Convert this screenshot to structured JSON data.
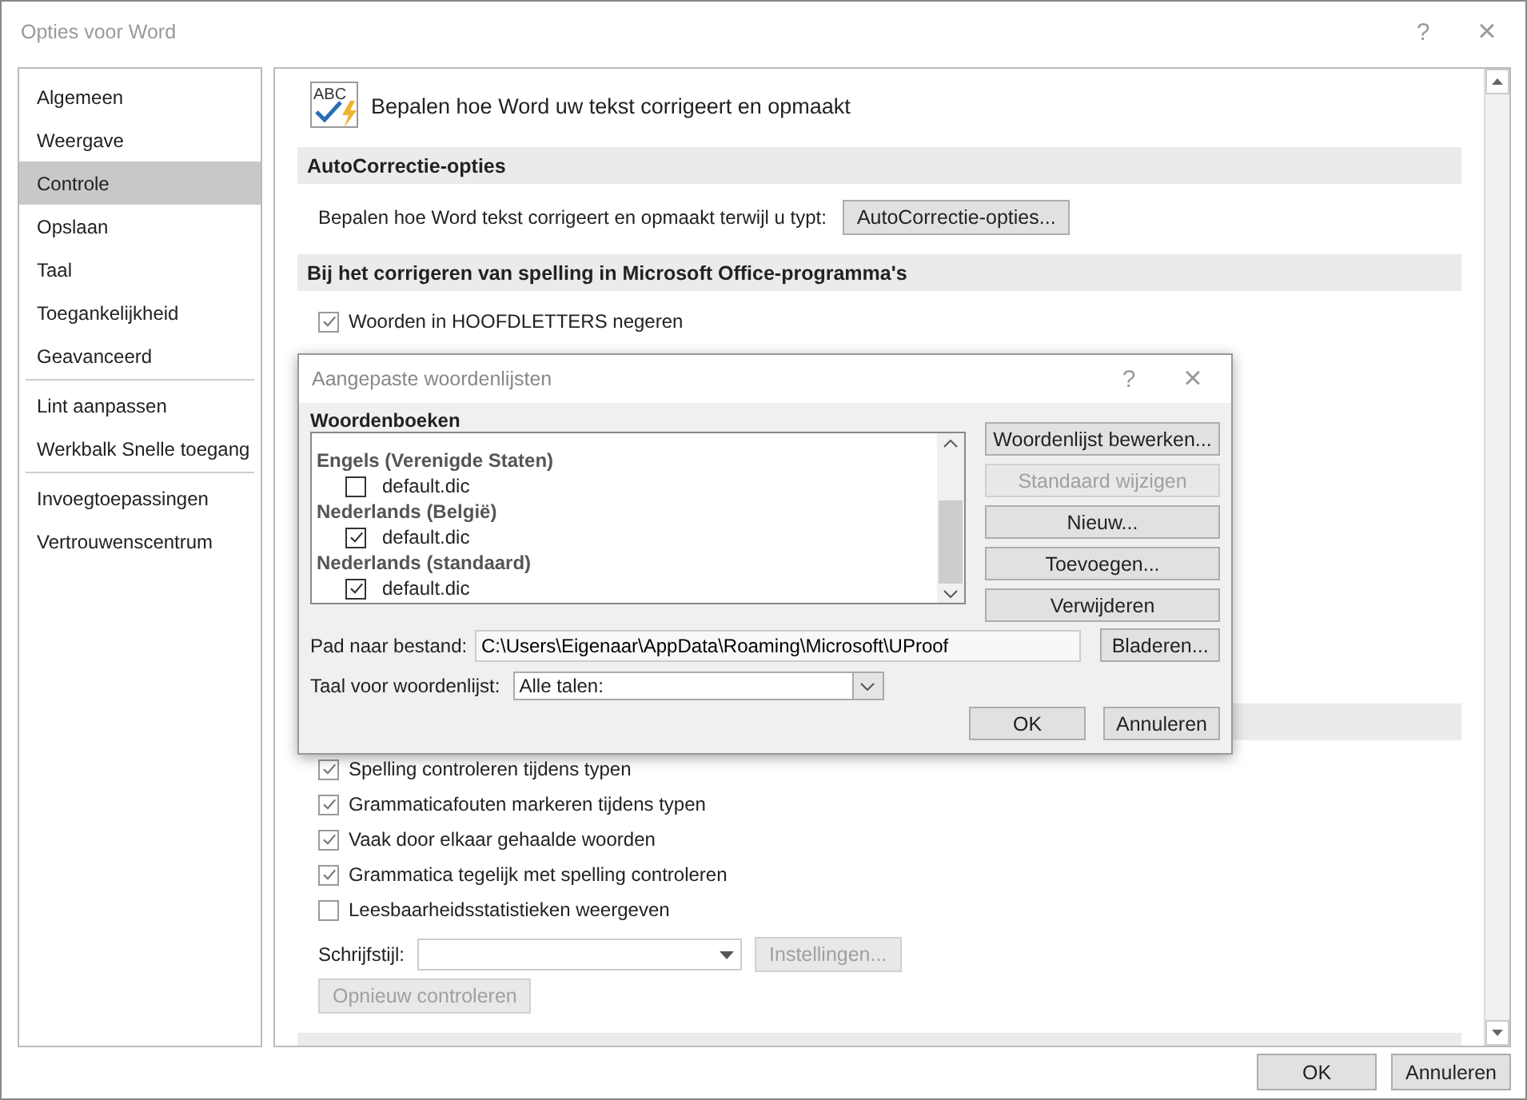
{
  "window": {
    "title": "Opties voor Word",
    "help": "?",
    "close": "×"
  },
  "sidebar": {
    "groups": [
      [
        {
          "label": "Algemeen",
          "selected": false
        },
        {
          "label": "Weergave",
          "selected": false
        },
        {
          "label": "Controle",
          "selected": true
        },
        {
          "label": "Opslaan",
          "selected": false
        },
        {
          "label": "Taal",
          "selected": false
        },
        {
          "label": "Toegankelijkheid",
          "selected": false
        },
        {
          "label": "Geavanceerd",
          "selected": false
        }
      ],
      [
        {
          "label": "Lint aanpassen",
          "selected": false
        },
        {
          "label": "Werkbalk Snelle toegang",
          "selected": false
        }
      ],
      [
        {
          "label": "Invoegtoepassingen",
          "selected": false
        },
        {
          "label": "Vertrouwenscentrum",
          "selected": false
        }
      ]
    ]
  },
  "main": {
    "icon_text": "ABC",
    "heading": "Bepalen hoe Word uw tekst corrigeert en opmaakt",
    "autocorrect": {
      "title": "AutoCorrectie-opties",
      "description": "Bepalen hoe Word tekst corrigeert en opmaakt terwijl u typt:",
      "button": "AutoCorrectie-opties..."
    },
    "spelling_office": {
      "title": "Bij het corrigeren van spelling in Microsoft Office-programma's",
      "options": [
        {
          "label": "Woorden in HOOFDLETTERS negeren",
          "checked": true
        }
      ]
    },
    "spelling_word": {
      "options": [
        {
          "label": "Spelling controleren tijdens typen",
          "checked": true
        },
        {
          "label": "Grammaticafouten markeren tijdens typen",
          "checked": true
        },
        {
          "label": "Vaak door elkaar gehaalde woorden",
          "checked": true
        },
        {
          "label": "Grammatica tegelijk met spelling controleren",
          "checked": true
        },
        {
          "label": "Leesbaarheidsstatistieken weergeven",
          "checked": false
        }
      ],
      "style_label": "Schrijfstijl:",
      "settings_button": {
        "label": "Instellingen...",
        "disabled": true
      },
      "recheck_button": {
        "label": "Opnieuw controleren",
        "disabled": true
      }
    }
  },
  "buttons": [
    {
      "label": "OK"
    },
    {
      "label": "Annuleren"
    }
  ],
  "dialog": {
    "title": "Aangepaste woordenlijsten",
    "help": "?",
    "close": "×",
    "list_title": "Woordenboeken",
    "dictionaries": [
      {
        "language": "Engels (Verenigde Staten)",
        "items": [
          {
            "name": "default.dic",
            "checked": false
          }
        ]
      },
      {
        "language": "Nederlands (België)",
        "items": [
          {
            "name": "default.dic",
            "checked": true
          }
        ]
      },
      {
        "language": "Nederlands (standaard)",
        "items": [
          {
            "name": "default.dic",
            "checked": true
          }
        ]
      }
    ],
    "side_buttons": [
      {
        "label": "Woordenlijst bewerken...",
        "disabled": false
      },
      {
        "label": "Standaard wijzigen",
        "disabled": true
      },
      {
        "label": "Nieuw...",
        "disabled": false
      },
      {
        "label": "Toevoegen...",
        "disabled": false
      },
      {
        "label": "Verwijderen",
        "disabled": false
      }
    ],
    "path_label": "Pad naar bestand:",
    "path": "C:\\Users\\Eigenaar\\AppData\\Roaming\\Microsoft\\UProof",
    "browse_button": "Bladeren...",
    "language_label": "Taal voor woordenlijst:",
    "language_value": "Alle talen:",
    "buttons": [
      {
        "label": "OK"
      },
      {
        "label": "Annuleren"
      }
    ]
  }
}
